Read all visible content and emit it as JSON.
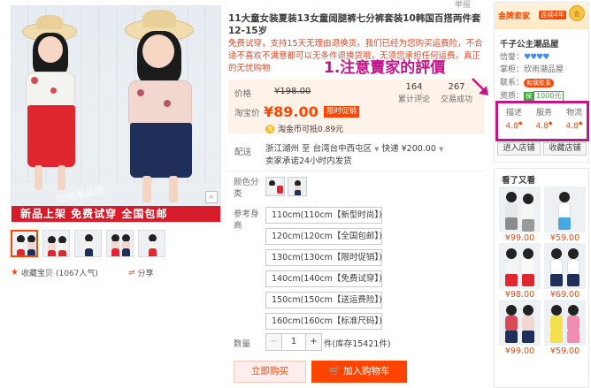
{
  "report": "举报",
  "product": {
    "title": "11大童女装夏装13女童阔腿裤七分裤套装10韩国百搭两件套12-15岁",
    "subtitle": "免费试穿，支持15天无理由退换货，我们已经为您购买运费险，不合适不喜欢不满意都可以无条件退换货哦，无须您承担任何运费。真正的无忧购物",
    "image_watermark": "欣雨潮品屋",
    "banner": "新品上架 免费试穿 全国包邮"
  },
  "price": {
    "label": "价格",
    "original": "¥198.00",
    "taobao_label": "淘宝价",
    "taobao_price": "¥89.00",
    "promo_tag": "限时促销",
    "reviews_count": "164",
    "reviews_label": "累计评论",
    "deals_count": "267",
    "deals_label": "交易成功"
  },
  "coin": {
    "text": "淘金币可抵0.89元"
  },
  "shipping": {
    "label": "配送",
    "origin": "浙江湖州",
    "to": "至",
    "destination": "台湾台中西屯区",
    "method": "快递",
    "fee": "¥200.00",
    "promise": "卖家承诺24小时内发货"
  },
  "color": {
    "label": "颜色分类"
  },
  "size": {
    "label": "参考身高",
    "options": [
      "110cm(110cm【新型时尚】)",
      "120cm(120cm【全国包邮】)",
      "130cm(130cm【限时促销】)",
      "140cm(140cm【免费试穿】)",
      "150cm(150cm【送运费险】)",
      "160cm(160cm【标准尺码】)"
    ]
  },
  "quantity": {
    "label": "数量",
    "minus": "−",
    "value": "1",
    "plus": "+",
    "stock": "件(库存15421件)"
  },
  "actions": {
    "buy_now": "立即购买",
    "add_cart": "加入购物车"
  },
  "gallery_actions": {
    "collect": "收藏宝贝",
    "collect_count": "(1067人气)",
    "share": "分享"
  },
  "annotation": {
    "text": "1.注意賣家的評價"
  },
  "shop": {
    "badge": "金牌卖家",
    "years": "连续4年",
    "crown": "金",
    "name": "千子公主潮品屋",
    "credit_label": "信誉：",
    "credit_hearts": "♥♥♥♥",
    "keeper_label": "掌柜：",
    "keeper": "欣雨潮品屋",
    "contact_label": "联系：",
    "contact": "和我联系",
    "deposit_label": "资质：",
    "deposit": "保",
    "deposit_amount": "1000元",
    "scores": [
      {
        "label": "描述",
        "value": "4.8"
      },
      {
        "label": "服务",
        "value": "4.8"
      },
      {
        "label": "物流",
        "value": "4.8"
      }
    ],
    "enter_btn": "进入店铺",
    "fav_btn": "收藏店铺"
  },
  "recommend": {
    "title": "看了又看",
    "items": [
      {
        "price": "¥99.00"
      },
      {
        "price": "¥59.00"
      },
      {
        "price": "¥98.00"
      },
      {
        "price": "¥69.00"
      },
      {
        "price": "¥99.00"
      },
      {
        "price": "¥59.00"
      }
    ]
  },
  "colors": {
    "accent": "#ff4400",
    "annotation": "#c0168a",
    "banner": "#d61b2a"
  }
}
